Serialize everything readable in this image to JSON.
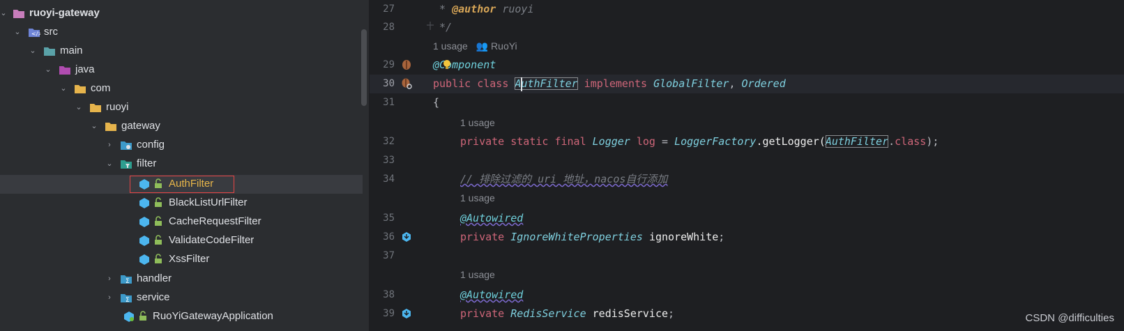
{
  "tree": {
    "items": [
      {
        "label": "ruoyi-gateway",
        "icon": "module-folder-icon"
      },
      {
        "label": "src",
        "icon": "source-folder-icon"
      },
      {
        "label": "main",
        "icon": "folder-icon"
      },
      {
        "label": "java",
        "icon": "java-source-root-icon"
      },
      {
        "label": "com",
        "icon": "package-folder-icon"
      },
      {
        "label": "ruoyi",
        "icon": "package-folder-icon"
      },
      {
        "label": "gateway",
        "icon": "package-folder-icon"
      },
      {
        "label": "config",
        "icon": "config-package-icon"
      },
      {
        "label": "filter",
        "icon": "filter-package-icon"
      },
      {
        "label": "AuthFilter",
        "icon": "class-icon"
      },
      {
        "label": "BlackListUrlFilter",
        "icon": "class-icon"
      },
      {
        "label": "CacheRequestFilter",
        "icon": "class-icon"
      },
      {
        "label": "ValidateCodeFilter",
        "icon": "class-icon"
      },
      {
        "label": "XssFilter",
        "icon": "class-icon"
      },
      {
        "label": "handler",
        "icon": "handler-package-icon"
      },
      {
        "label": "service",
        "icon": "service-package-icon"
      },
      {
        "label": "RuoYiGatewayApplication",
        "icon": "spring-boot-app-icon"
      }
    ]
  },
  "editor": {
    "lines": {
      "n27": "27",
      "n28": "28",
      "n29": "29",
      "n30": "30",
      "n31": "31",
      "n32": "32",
      "n33": "33",
      "n34": "34",
      "n35": "35",
      "n36": "36",
      "n37": "37",
      "n38": "38",
      "n39": "39"
    },
    "code": {
      "l27_star": " * ",
      "l27_tag": "@author",
      "l27_name": " ruoyi",
      "l28": " */",
      "hint1_usage": "1 usage",
      "hint1_author": "RuoYi",
      "l29_at": "@",
      "l29_ann": "Component",
      "l30_public": "public",
      "l30_class": "class",
      "l30_name": "AuthFilter",
      "l30_impl": "implements",
      "l30_if1": "GlobalFilter",
      "l30_comma": ", ",
      "l30_if2": "Ordered",
      "l31": "{",
      "hint2_usage": "1 usage",
      "l32_mods": "private static final",
      "l32_type": "Logger",
      "l32_var": "log",
      "l32_eq": " = ",
      "l32_factory": "LoggerFactory",
      "l32_method": ".getLogger(",
      "l32_arg": "AuthFilter",
      "l32_dot": ".",
      "l32_cls": "class",
      "l32_end": ");",
      "l34_comment": "// 排除过滤的 uri 地址，nacos自行添加",
      "hint3_usage": "1 usage",
      "l35_ann": "@Autowired",
      "l36_mod": "private",
      "l36_type": "IgnoreWhiteProperties",
      "l36_var": "ignoreWhite",
      "l36_end": ";",
      "hint4_usage": "1 usage",
      "l38_ann": "@Autowired",
      "l39_mod": "private",
      "l39_type": "RedisService",
      "l39_var": "redisService",
      "l39_end": ";"
    }
  },
  "watermark": "CSDN @difficulties",
  "colors": {
    "accent_selected": "#e8b64a",
    "selection_border": "#e84545",
    "keyword": "#cf6679",
    "type": "#7fd0df"
  }
}
